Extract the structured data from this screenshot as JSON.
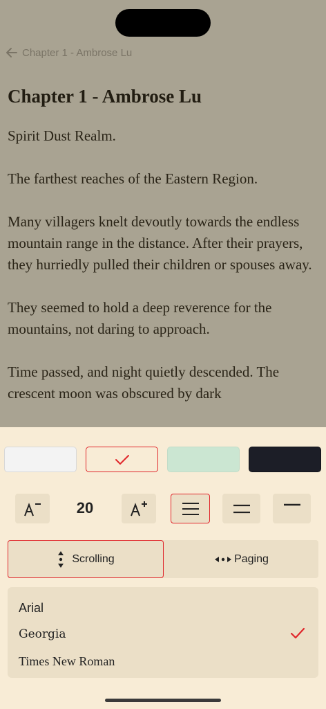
{
  "header": {
    "back_label": "Chapter 1 - Ambrose Lu"
  },
  "chapter": {
    "title": "Chapter 1 - Ambrose Lu",
    "paragraphs": [
      "Spirit Dust Realm.",
      "The farthest reaches of the Eastern Region.",
      "Many villagers knelt devoutly towards the endless mountain range in the distance. After their prayers, they hurriedly pulled their children or spouses away.",
      "They seemed to hold a deep reverence for the mountains, not daring to approach.",
      "Time passed, and night quietly descended. The crescent moon was obscured by dark"
    ]
  },
  "settings": {
    "themes": [
      {
        "name": "white",
        "color": "#f3f3f3",
        "selected": false
      },
      {
        "name": "sepia",
        "color": "#f8ecd6",
        "selected": true
      },
      {
        "name": "green",
        "color": "#cbe6d2",
        "selected": false
      },
      {
        "name": "dark",
        "color": "#1c1e27",
        "selected": false
      }
    ],
    "font_size": "20",
    "line_spacing_selected": "wide",
    "modes": {
      "scrolling": "Scrolling",
      "paging": "Paging",
      "selected": "scrolling"
    },
    "fonts": [
      {
        "name": "Arial",
        "selected": false
      },
      {
        "name": "Georgia",
        "selected": true
      },
      {
        "name": "Times New Roman",
        "selected": false
      }
    ],
    "accent_color": "#e0262b"
  }
}
